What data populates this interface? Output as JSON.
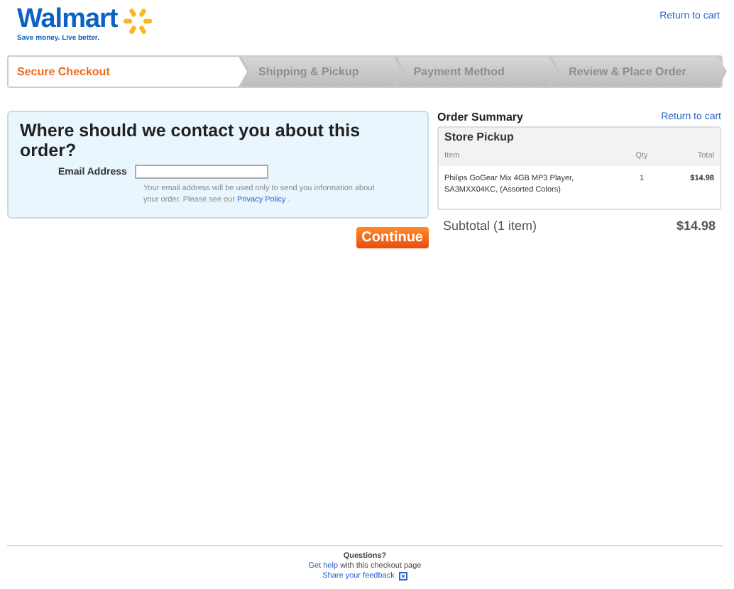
{
  "header": {
    "logo": "Walmart",
    "tagline": "Save money. Live better.",
    "return_link": "Return to cart"
  },
  "steps": [
    {
      "label": "Secure Checkout",
      "selected": true
    },
    {
      "label": "Shipping & Pickup",
      "selected": false
    },
    {
      "label": "Payment Method",
      "selected": false
    },
    {
      "label": "Review & Place Order",
      "selected": false
    }
  ],
  "contact": {
    "title": "Where should we contact you about this order?",
    "email_label": "Email Address",
    "note": "Your email address will be used only to send you information about your order. Please see our",
    "note_link": "Privacy Policy",
    "note_end": ".",
    "button": "Continue"
  },
  "summary": {
    "title": "Order Summary",
    "return_link": "Return to cart",
    "section": "Store Pickup",
    "columns": [
      "Item",
      "Qty",
      "Total"
    ],
    "rows": [
      {
        "item": "Philips GoGear Mix 4GB MP3 Player, SA3MXX04KC, (Assorted Colors)",
        "qty": "1",
        "total": "$14.98"
      }
    ],
    "subtotal_label": "Subtotal (1 item)",
    "subtotal": "$14.98"
  },
  "footer": {
    "title": "Questions?",
    "help_link": "Get help",
    "help_text": "with this checkout page",
    "feedback_link": "Share your feedback"
  }
}
